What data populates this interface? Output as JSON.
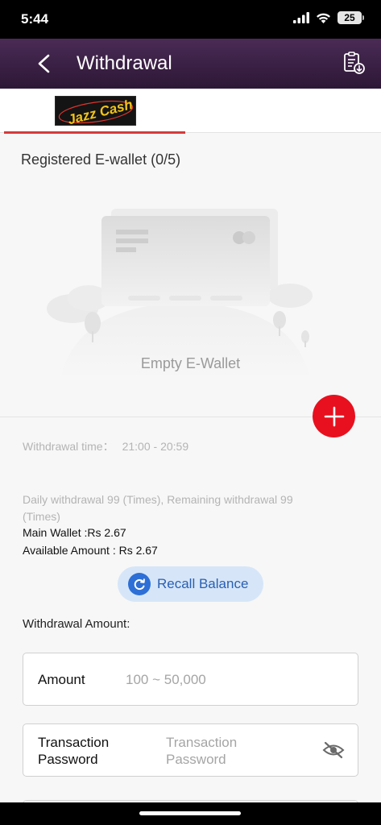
{
  "status_bar": {
    "time": "5:44",
    "battery": "25"
  },
  "header": {
    "title": "Withdrawal",
    "back_icon": "chevron-left-icon",
    "records_icon": "clipboard-download-icon"
  },
  "tabs": [
    {
      "logo_text": "Jazz Cash",
      "selected": true
    }
  ],
  "wallet": {
    "title": "Registered E-wallet (0/5)",
    "empty_label": "Empty E-Wallet"
  },
  "withdrawal_time": {
    "label": "Withdrawal time：",
    "value": "21:00 - 20:59"
  },
  "limits": {
    "daily_text": "Daily withdrawal 99 (Times), Remaining withdrawal 99 (Times)",
    "main_wallet": "Main Wallet :Rs 2.67",
    "available_amount": "Available Amount : Rs 2.67"
  },
  "recall": {
    "label": "Recall Balance"
  },
  "form": {
    "heading": "Withdrawal Amount:",
    "amount_label": "Amount",
    "amount_placeholder": "100 ~ 50,000",
    "password_label": "Transaction Password",
    "password_placeholder": "Transaction Password"
  },
  "colors": {
    "header_bg": "#3b2145",
    "accent_red": "#e8101e",
    "tab_underline": "#d63a3a",
    "recall_bg": "#d6e6f8",
    "recall_text": "#2a5fb3"
  }
}
